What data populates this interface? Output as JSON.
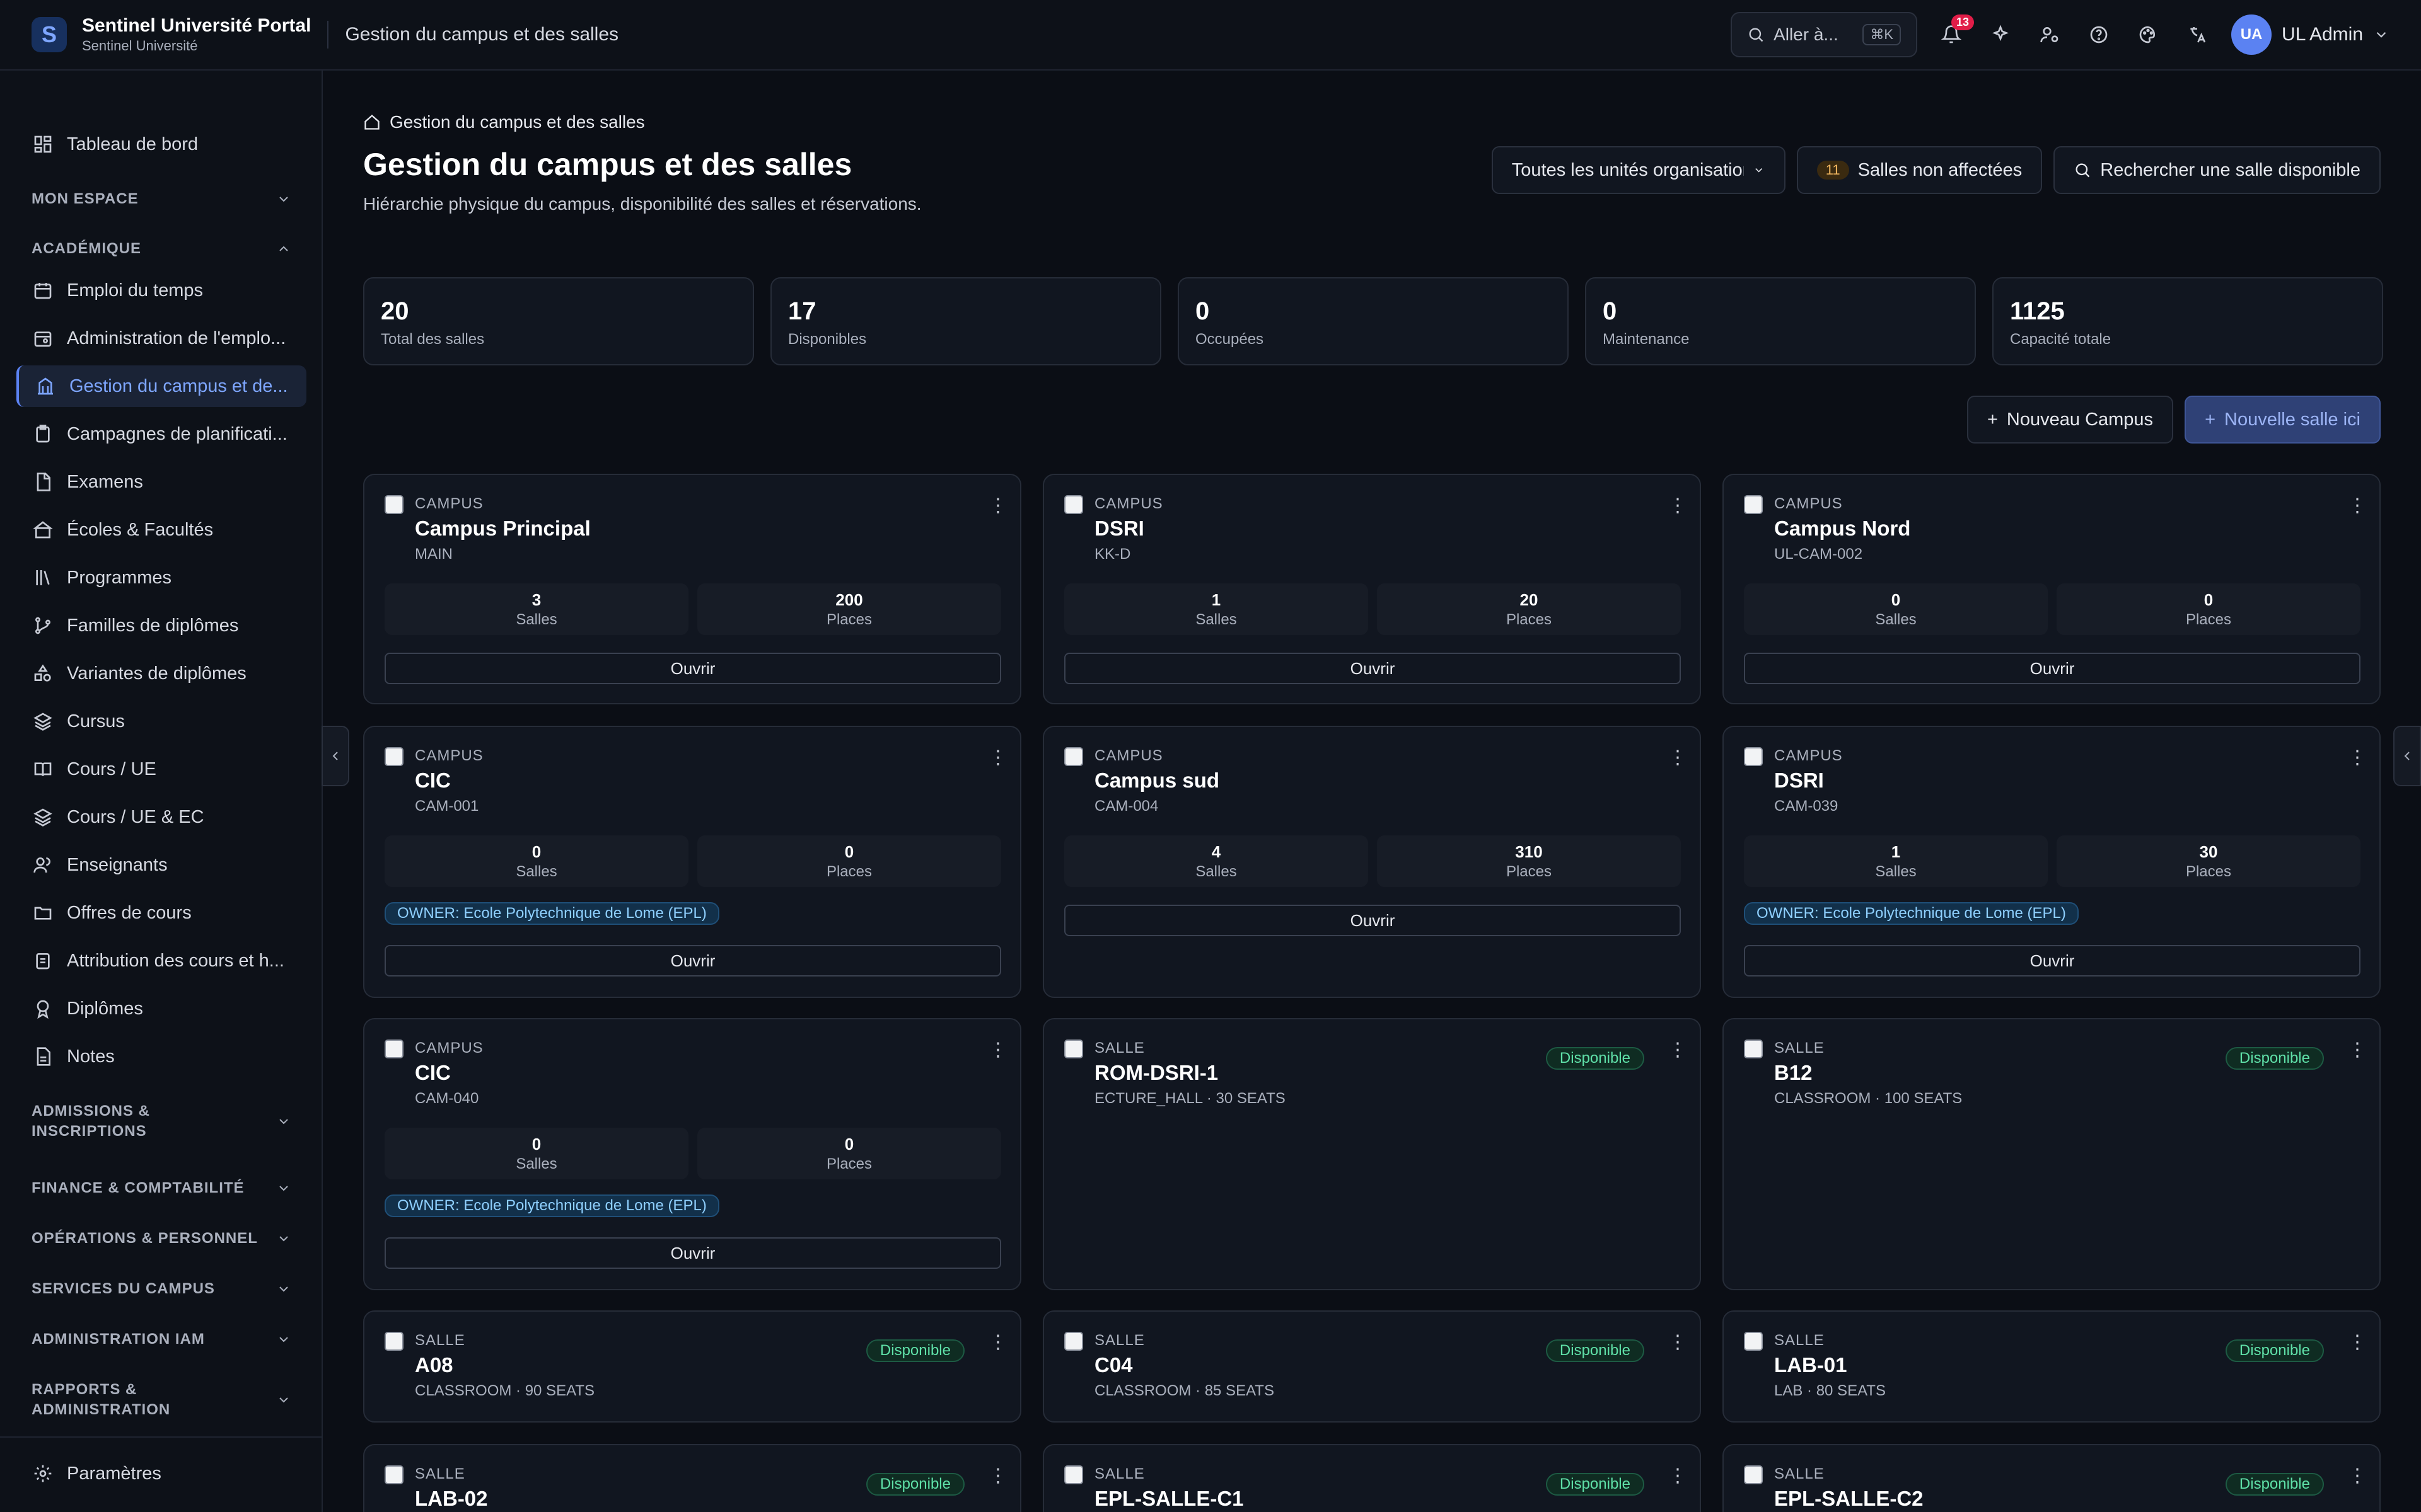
{
  "topbar": {
    "brand_title": "Sentinel Université Portal",
    "brand_sub": "Sentinel Université",
    "logo_letter": "S",
    "page": "Gestion du campus et des salles",
    "goto_label": "Aller à...",
    "goto_kbd": "⌘K",
    "notifications": "13",
    "avatar_initials": "UA",
    "user_name": "UL Admin"
  },
  "sidebar": {
    "dashboard": "Tableau de bord",
    "section_mon_espace": "MON ESPACE",
    "section_academique": "ACADÉMIQUE",
    "items": [
      "Emploi du temps",
      "Administration de l'emplo...",
      "Gestion du campus et de...",
      "Campagnes de planificati...",
      "Examens",
      "Écoles & Facultés",
      "Programmes",
      "Familles de diplômes",
      "Variantes de diplômes",
      "Cursus",
      "Cours / UE",
      "Cours / UE & EC",
      "Enseignants",
      "Offres de cours",
      "Attribution des cours et h...",
      "Diplômes",
      "Notes"
    ],
    "sections_bottom": [
      "ADMISSIONS & INSCRIPTIONS",
      "FINANCE & COMPTABILITÉ",
      "OPÉRATIONS & PERSONNEL",
      "SERVICES DU CAMPUS",
      "ADMINISTRATION IAM",
      "RAPPORTS & ADMINISTRATION"
    ],
    "settings": "Paramètres"
  },
  "header": {
    "breadcrumb": "Gestion du campus et des salles",
    "title": "Gestion du campus et des salles",
    "subtitle": "Hiérarchie physique du campus, disponibilité des salles et réservations.",
    "org_select": "Toutes les unités organisationnelles",
    "unassigned_count": "11",
    "unassigned_label": "Salles non affectées",
    "search_room": "Rechercher une salle disponible"
  },
  "stats": [
    {
      "value": "20",
      "label": "Total des salles"
    },
    {
      "value": "17",
      "label": "Disponibles"
    },
    {
      "value": "0",
      "label": "Occupées"
    },
    {
      "value": "0",
      "label": "Maintenance"
    },
    {
      "value": "1125",
      "label": "Capacité totale"
    }
  ],
  "buttons": {
    "new_campus": "Nouveau Campus",
    "new_room": "Nouvelle salle ici"
  },
  "labels": {
    "rooms": "Salles",
    "places": "Places",
    "open": "Ouvrir",
    "available": "Disponible"
  },
  "campuses": [
    {
      "type": "CAMPUS",
      "name": "Campus Principal",
      "code": "MAIN",
      "rooms": "3",
      "places": "200",
      "owner": ""
    },
    {
      "type": "CAMPUS",
      "name": "DSRI",
      "code": "KK-D",
      "rooms": "1",
      "places": "20",
      "owner": ""
    },
    {
      "type": "CAMPUS",
      "name": "Campus Nord",
      "code": "UL-CAM-002",
      "rooms": "0",
      "places": "0",
      "owner": ""
    },
    {
      "type": "CAMPUS",
      "name": "CIC",
      "code": "CAM-001",
      "rooms": "0",
      "places": "0",
      "owner": "OWNER: Ecole Polytechnique de Lome (EPL)"
    },
    {
      "type": "CAMPUS",
      "name": "Campus sud",
      "code": "CAM-004",
      "rooms": "4",
      "places": "310",
      "owner": ""
    },
    {
      "type": "CAMPUS",
      "name": "DSRI",
      "code": "CAM-039",
      "rooms": "1",
      "places": "30",
      "owner": "OWNER: Ecole Polytechnique de Lome (EPL)"
    },
    {
      "type": "CAMPUS",
      "name": "CIC",
      "code": "CAM-040",
      "rooms": "0",
      "places": "0",
      "owner": "OWNER: Ecole Polytechnique de Lome (EPL)"
    }
  ],
  "rooms": [
    {
      "type": "SALLE",
      "name": "ROM-DSRI-1",
      "meta": "ECTURE_HALL · 30 SEATS"
    },
    {
      "type": "SALLE",
      "name": "B12",
      "meta": "CLASSROOM · 100 SEATS"
    },
    {
      "type": "SALLE",
      "name": "A08",
      "meta": "CLASSROOM · 90 SEATS"
    },
    {
      "type": "SALLE",
      "name": "C04",
      "meta": "CLASSROOM · 85 SEATS"
    },
    {
      "type": "SALLE",
      "name": "LAB-01",
      "meta": "LAB · 80 SEATS"
    },
    {
      "type": "SALLE",
      "name": "LAB-02",
      "meta": ""
    },
    {
      "type": "SALLE",
      "name": "EPL-SALLE-C1",
      "meta": ""
    },
    {
      "type": "SALLE",
      "name": "EPL-SALLE-C2",
      "meta": ""
    }
  ],
  "colors": {
    "accent": "#5b82f2",
    "available_text": "#5fe0a8",
    "owner_text": "#8fd0ff",
    "notification": "#e11d48"
  }
}
